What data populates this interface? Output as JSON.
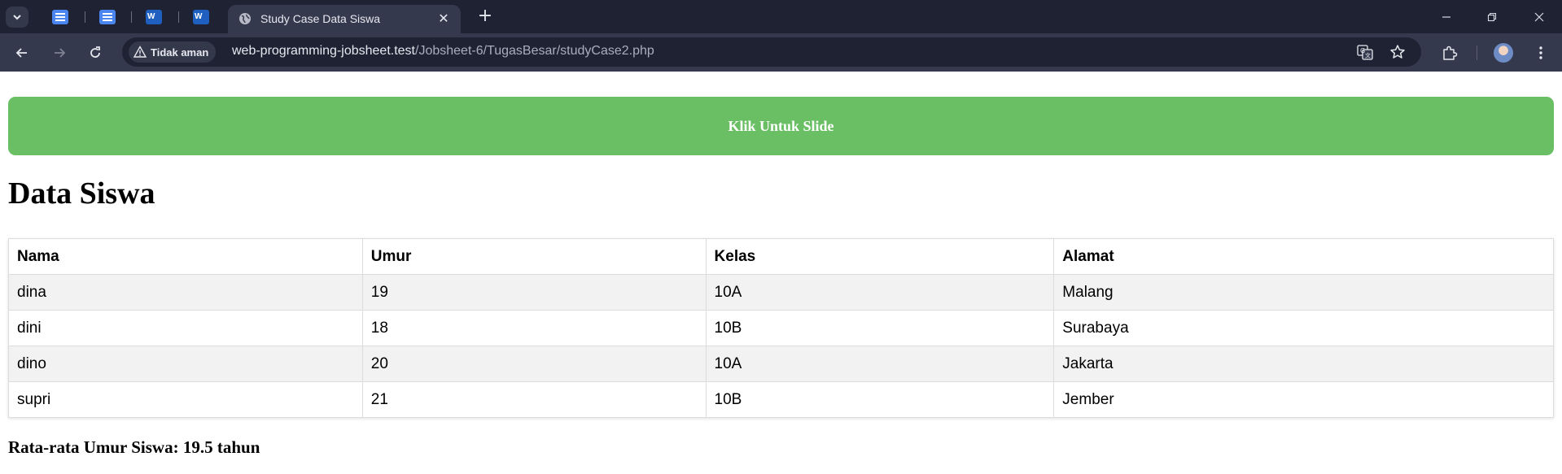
{
  "browser": {
    "active_tab_title": "Study Case Data Siswa",
    "security_label": "Tidak aman",
    "url_host": "web-programming-jobsheet.test",
    "url_path": "/Jobsheet-6/TugasBesar/studyCase2.php"
  },
  "page": {
    "slide_button_label": "Klik Untuk Slide",
    "title": "Data Siswa",
    "table": {
      "headers": [
        "Nama",
        "Umur",
        "Kelas",
        "Alamat"
      ],
      "rows": [
        [
          "dina",
          "19",
          "10A",
          "Malang"
        ],
        [
          "dini",
          "18",
          "10B",
          "Surabaya"
        ],
        [
          "dino",
          "20",
          "10A",
          "Jakarta"
        ],
        [
          "supri",
          "21",
          "10B",
          "Jember"
        ]
      ]
    },
    "average_text": "Rata-rata Umur Siswa: 19.5 tahun"
  },
  "icons": {
    "tab_search": "chevron-down-icon",
    "pinned_tabs": [
      "google-docs-icon",
      "google-docs-icon",
      "word-icon",
      "word-icon"
    ],
    "active_tab": "globe-icon",
    "translate": "translate-icon",
    "bookmark": "star-icon",
    "extensions": "puzzle-icon"
  },
  "colors": {
    "slide_button": "#6abf65",
    "tabbar": "#1f2233",
    "toolbar": "#35394d"
  }
}
